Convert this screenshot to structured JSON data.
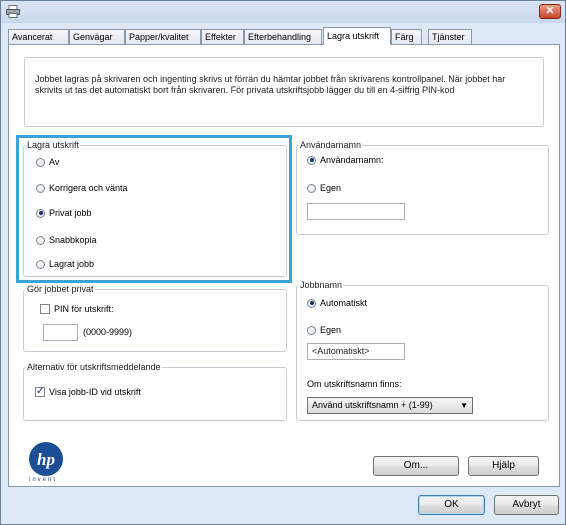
{
  "window": {
    "close_label": "✕"
  },
  "tabs": [
    {
      "label": "Avancerat"
    },
    {
      "label": "Genvägar"
    },
    {
      "label": "Papper/kvalitet"
    },
    {
      "label": "Effekter"
    },
    {
      "label": "Efterbehandling"
    },
    {
      "label": "Lagra utskrift",
      "active": true
    },
    {
      "label": "Färg"
    },
    {
      "label": "Tjänster"
    }
  ],
  "description": "Jobbet lagras på skrivaren och ingenting skrivs ut förrän du hämtar jobbet från skrivarens kontrollpanel. När jobbet har skrivits ut tas det automatiskt bort från skrivaren. För privata utskriftsjobb lägger du till en 4-siffrig PIN-kod",
  "job_storage": {
    "legend": "Lagra utskrift",
    "options": [
      {
        "label": "Av",
        "selected": false
      },
      {
        "label": "Korrigera och vänta",
        "selected": false
      },
      {
        "label": "Privat jobb",
        "selected": true
      },
      {
        "label": "Snabbkopia",
        "selected": false
      },
      {
        "label": "Lagrat jobb",
        "selected": false
      }
    ]
  },
  "username": {
    "legend": "Användarnamn",
    "options": [
      {
        "label": "Användarnamn:",
        "selected": true
      },
      {
        "label": "Egen",
        "selected": false
      }
    ],
    "custom_value": ""
  },
  "make_private": {
    "legend": "Gör jobbet privat",
    "pin_label": "PIN för utskrift:",
    "pin_checked": false,
    "pin_value": "",
    "pin_hint": "(0000-9999)"
  },
  "job_name": {
    "legend": "Jobbnamn",
    "options": [
      {
        "label": "Automatiskt",
        "selected": true
      },
      {
        "label": "Egen",
        "selected": false
      }
    ],
    "custom_value": "<Automatiskt>",
    "exists_label": "Om utskriftsnamn finns:",
    "exists_value": "Använd utskriftsnamn + (1-99)"
  },
  "notification": {
    "legend": "Alternativ för utskriftsmeddelande",
    "show_id_label": "Visa jobb-ID vid utskrift",
    "show_id_checked": true
  },
  "buttons": {
    "about": "Om...",
    "help": "Hjälp",
    "ok": "OK",
    "cancel": "Avbryt"
  },
  "logo": {
    "brand": "hp",
    "tagline": "invent"
  }
}
